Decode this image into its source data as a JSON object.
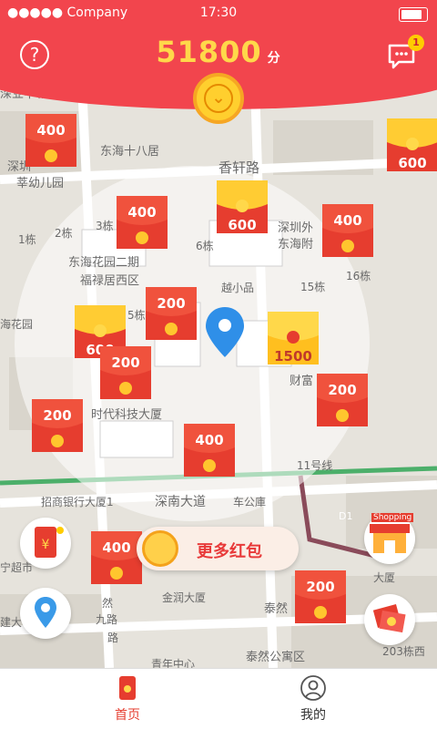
{
  "status_bar": {
    "carrier": "●●●●● Company",
    "time": "17:30"
  },
  "header": {
    "score": "51800",
    "score_unit": "分",
    "help_icon": "help-icon",
    "message_icon": "chat-icon",
    "message_badge": "1"
  },
  "map": {
    "labels": [
      "深业中城",
      "东海十八居",
      "香轩路",
      "深圳",
      "莘幼儿园",
      "东海花园二期",
      "福禄居西区",
      "越小品",
      "深圳外",
      "东海附",
      "16栋",
      "15栋",
      "6栋",
      "5栋",
      "1栋",
      "2栋",
      "3栋",
      "时代科技大厦",
      "财富",
      "招商银行大厦1",
      "深南大道",
      "车公庫",
      "11号线",
      "海花园",
      "宁超市",
      "金润大厦",
      "泰然",
      "九路",
      "建大",
      "泰然公寓区",
      "203栋西",
      "大厦",
      "然",
      "路",
      "D1",
      "青年中心"
    ],
    "envelopes": [
      {
        "value": "400",
        "style": "red"
      },
      {
        "value": "600",
        "style": "gold"
      },
      {
        "value": "400",
        "style": "red"
      },
      {
        "value": "600",
        "style": "gold"
      },
      {
        "value": "400",
        "style": "red"
      },
      {
        "value": "200",
        "style": "red"
      },
      {
        "value": "600",
        "style": "gold"
      },
      {
        "value": "200",
        "style": "red"
      },
      {
        "value": "1500",
        "style": "gold"
      },
      {
        "value": "200",
        "style": "red"
      },
      {
        "value": "200",
        "style": "red"
      },
      {
        "value": "400",
        "style": "red"
      },
      {
        "value": "400",
        "style": "red"
      },
      {
        "value": "200",
        "style": "red"
      }
    ]
  },
  "more_button": {
    "label": "更多红包"
  },
  "side_buttons": [
    "red-packet-icon",
    "location-icon",
    "shopping-store-icon",
    "cash-gift-icon"
  ],
  "shop_sign": "Shopping",
  "bottom_nav": [
    {
      "label": "首页",
      "active": true
    },
    {
      "label": "我的",
      "active": false
    }
  ],
  "colors": {
    "primary": "#f2454d",
    "gold": "#ffd84a",
    "map_bg": "#e9e6df"
  }
}
